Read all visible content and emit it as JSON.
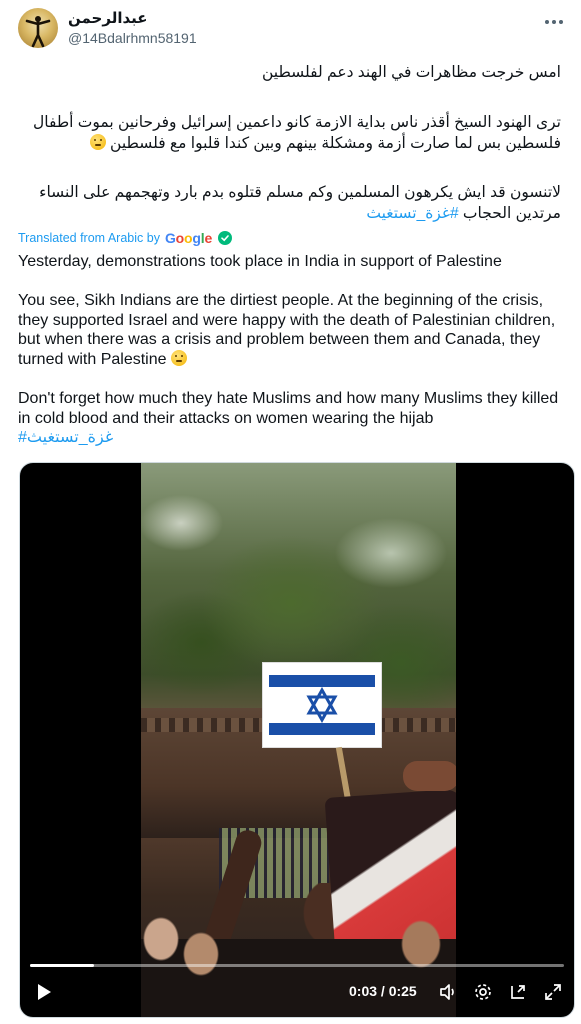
{
  "author": {
    "display_name": "عبدالرحمن",
    "handle": "@14Bdalrhmn58191"
  },
  "tweet": {
    "arabic_line1": "امس خرجت مظاهرات في الهند دعم لفلسطين",
    "arabic_para2_a": "ترى الهنود السيخ أقذر ناس بداية الازمة كانو داعمين إسرائيل وفرحانين بموت أطفال",
    "arabic_para2_b": "فلسطين بس لما صارت أزمة ومشكلة بينهم وبين كندا قلبوا مع فلسطين",
    "arabic_para3_a": "لاتنسون قد ايش يكرهون المسلمين وكم مسلم قتلوه بدم بارد وتهجمهم على النساء",
    "arabic_para3_b": "مرتدين الحجاب",
    "arabic_hashtag": "#غزة_تستغيث"
  },
  "translation": {
    "label": "Translated from Arabic by",
    "provider": {
      "letters": [
        "G",
        "o",
        "o",
        "g",
        "l",
        "e"
      ]
    },
    "line1": "Yesterday, demonstrations took place in India in support of Palestine",
    "para2": "You see, Sikh Indians are the dirtiest people. At the beginning of the crisis, they supported Israel and were happy with the death of Palestinian children, but when there was a crisis and problem between them and Canada, they turned with Palestine",
    "para3": "Don't forget how much they hate Muslims and how many Muslims they killed in cold blood and their attacks on women wearing the hijab",
    "hashtag": "#غزة_تستغيث"
  },
  "video": {
    "time": "0:03 / 0:25",
    "progress": 0.12
  },
  "icons": {
    "more": "more-icon",
    "play": "play-icon",
    "volume": "volume-icon",
    "settings": "settings-icon",
    "exit_fullscreen": "pip-icon",
    "fullscreen": "fullscreen-icon",
    "verified": "check-icon"
  },
  "colors": {
    "link": "#1d9bf0",
    "text": "#0f1419",
    "secondary": "#536471"
  }
}
